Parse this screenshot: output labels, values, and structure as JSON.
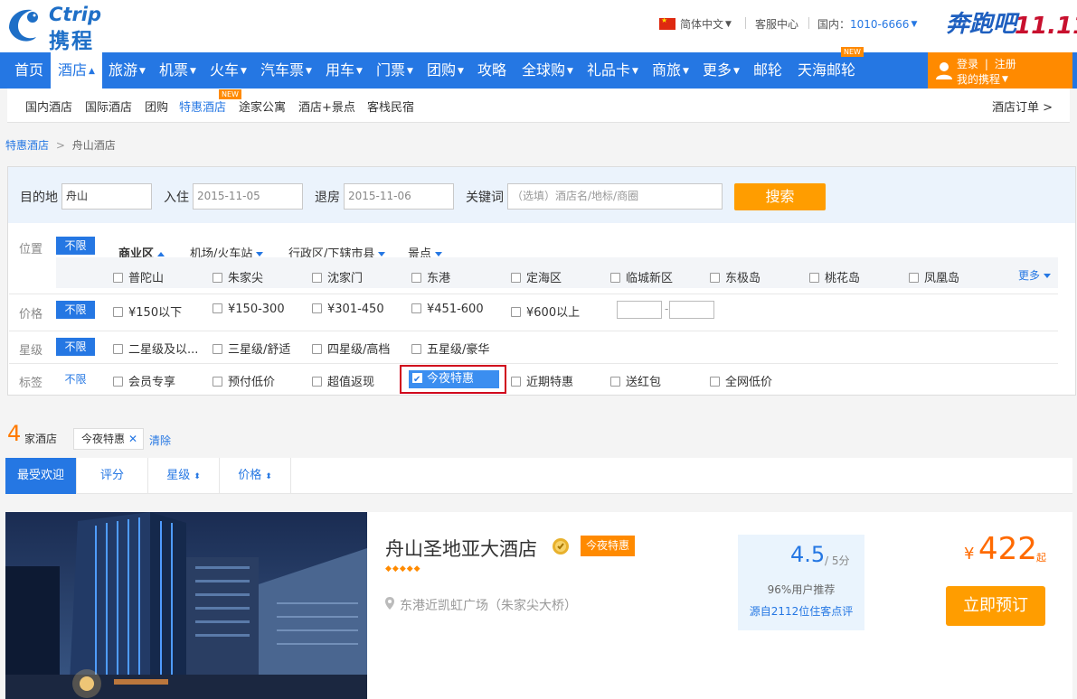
{
  "brand": {
    "name_en": "Ctrip",
    "name_cn": "携程"
  },
  "top": {
    "language": "简体中文",
    "service": "客服中心",
    "phone_label": "国内：",
    "phone": "1010-6666",
    "promo_text": "奔跑吧",
    "promo_num": "11.11"
  },
  "nav": {
    "items": [
      {
        "label": "首页"
      },
      {
        "label": "酒店"
      },
      {
        "label": "旅游"
      },
      {
        "label": "机票"
      },
      {
        "label": "火车"
      },
      {
        "label": "汽车票"
      },
      {
        "label": "用车"
      },
      {
        "label": "门票"
      },
      {
        "label": "团购"
      },
      {
        "label": "攻略"
      },
      {
        "label": "全球购"
      },
      {
        "label": "礼品卡"
      },
      {
        "label": "商旅"
      },
      {
        "label": "更多"
      },
      {
        "label": "邮轮"
      },
      {
        "label": "天海邮轮"
      }
    ],
    "new_tag": "NEW",
    "login": "登录",
    "register": "注册",
    "my": "我的携程"
  },
  "subnav": {
    "items": [
      "国内酒店",
      "国际酒店",
      "团购",
      "特惠酒店",
      "途家公寓",
      "酒店+景点",
      "客栈民宿"
    ],
    "orders": "酒店订单 >"
  },
  "breadcrumb": {
    "root": "特惠酒店",
    "sep": ">",
    "current": "舟山酒店"
  },
  "search": {
    "dest_label": "目的地",
    "dest_value": "舟山",
    "checkin_label": "入住",
    "checkin_value": "2015-11-05",
    "checkout_label": "退房",
    "checkout_value": "2015-11-06",
    "keyword_label": "关键词",
    "keyword_placeholder": "（选填）酒店名/地标/商圈",
    "button": "搜索"
  },
  "filters": {
    "location_label": "位置",
    "unlimited": "不限",
    "location_tabs": [
      "商业区",
      "机场/火车站",
      "行政区/下辖市县",
      "景点"
    ],
    "districts": [
      "普陀山",
      "朱家尖",
      "沈家门",
      "东港",
      "定海区",
      "临城新区",
      "东极岛",
      "桃花岛",
      "凤凰岛"
    ],
    "more": "更多",
    "price_label": "价格",
    "prices": [
      "¥150以下",
      "¥150-300",
      "¥301-450",
      "¥451-600",
      "¥600以上"
    ],
    "price_dash": "-",
    "star_label": "星级",
    "stars": [
      "二星级及以...",
      "三星级/舒适",
      "四星级/高档",
      "五星级/豪华"
    ],
    "tag_label": "标签",
    "tags": [
      "会员专享",
      "预付低价",
      "超值返现",
      "今夜特惠",
      "近期特惠",
      "送红包",
      "全网低价"
    ]
  },
  "results": {
    "count": "4",
    "count_label": "家酒店",
    "active_tag": "今夜特惠",
    "clear": "清除"
  },
  "sort": {
    "items": [
      "最受欢迎",
      "评分",
      "星级",
      "价格"
    ]
  },
  "hotel": {
    "name": "舟山圣地亚大酒店",
    "badge": "今夜特惠",
    "diamonds": "◆◆◆◆◆",
    "address": "东港近凯虹广场（朱家尖大桥）",
    "score": "4.5",
    "score_max": "/ 5分",
    "recommend": "96%用户推荐",
    "reviews": "源自2112位住客点评",
    "currency": "¥",
    "price": "422",
    "price_suffix": "起",
    "book": "立即预订"
  },
  "colors": {
    "brand_blue": "#2577e3",
    "orange": "#ff8a00",
    "price": "#ff6a00",
    "highlight": "#d0021b"
  }
}
